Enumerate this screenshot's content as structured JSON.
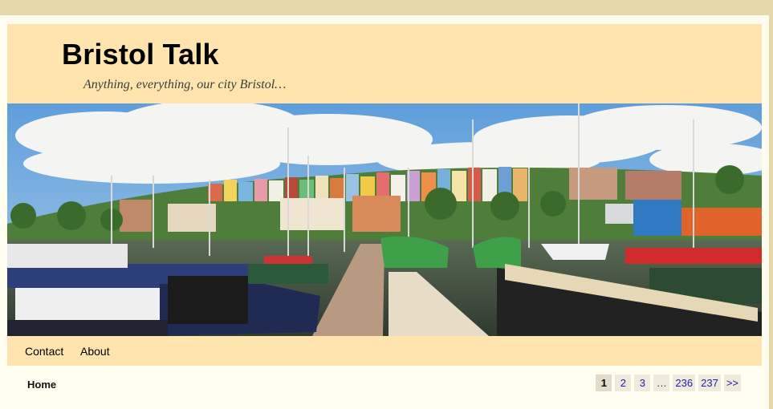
{
  "header": {
    "site_title": "Bristol Talk",
    "tagline": "Anything, everything, our city Bristol…"
  },
  "nav": {
    "items": [
      {
        "label": "Contact"
      },
      {
        "label": "About"
      }
    ]
  },
  "breadcrumb": {
    "home": "Home"
  },
  "pagination": {
    "pages": [
      "1",
      "2",
      "3",
      "…",
      "236",
      "237",
      ">>"
    ],
    "current": "1"
  },
  "colors": {
    "page_background": "#e5d8a9",
    "header_background": "#ffe4ad",
    "content_background": "#fffdf0",
    "link": "#1a1fa8"
  }
}
